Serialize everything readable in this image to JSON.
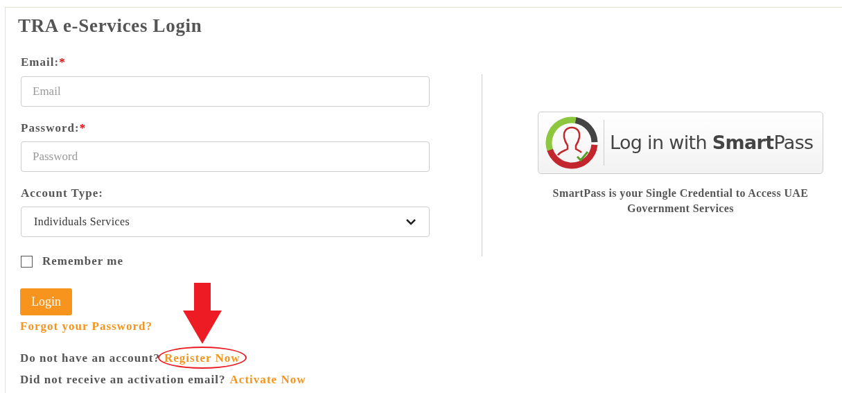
{
  "title": "TRA e-Services Login",
  "email": {
    "label": "Email:",
    "required_mark": "*",
    "placeholder": "Email"
  },
  "password": {
    "label": "Password:",
    "required_mark": "*",
    "placeholder": "Password"
  },
  "account_type": {
    "label": "Account Type:",
    "value": "Individuals Services"
  },
  "remember": {
    "label": "Remember me",
    "checked": false
  },
  "login_button": "Login",
  "forgot_link": "Forgot your Password?",
  "register": {
    "text": "Do not have an account?",
    "link": "Register Now",
    "highlighted": true
  },
  "activate": {
    "text": "Did not receive an activation email?",
    "link": "Activate Now"
  },
  "smartpass": {
    "button": "Log in with **Smart**Pass",
    "caption": "SmartPass is your Single Credential to Access UAE Government Services"
  }
}
